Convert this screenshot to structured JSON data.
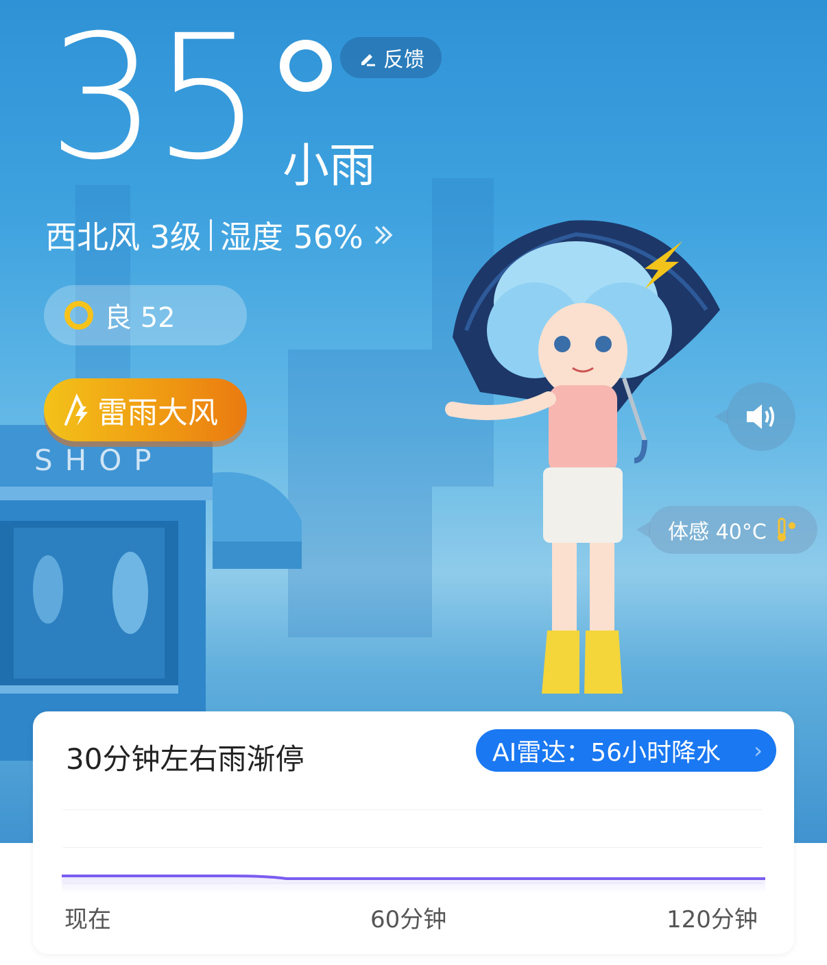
{
  "weather": {
    "temperature": "35",
    "condition": "小雨",
    "feedback_label": "反馈",
    "wind": "西北风 3级",
    "humidity": "湿度 56%",
    "aqi_label": "良 52",
    "alert_label": "雷雨大风",
    "feels_like": "体感 40°C",
    "shop_sign": "SHOP"
  },
  "forecast": {
    "title": "30分钟左右雨渐停",
    "radar_label": "AI雷达：56小时降水",
    "axis": [
      "现在",
      "60分钟",
      "120分钟"
    ]
  },
  "colors": {
    "accent": "#1a78f2",
    "alert": "#f0a013",
    "aqi_ring": "#f7c21a",
    "line": "#7b5cf0"
  },
  "icons": [
    "edit-icon",
    "chevrons-right-icon",
    "lightning-warning-icon",
    "speaker-icon",
    "thermometer-sun-icon",
    "chevron-right-icon"
  ]
}
